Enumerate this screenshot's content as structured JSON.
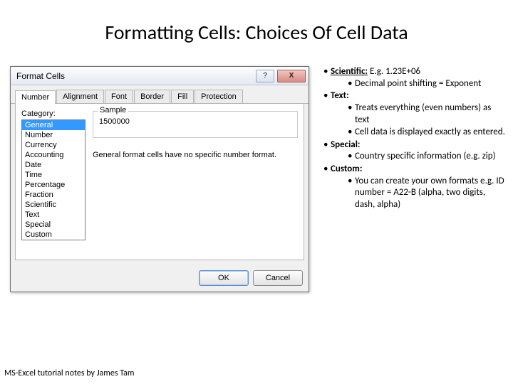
{
  "title": "Formatting Cells: Choices Of Cell Data",
  "dialog": {
    "title": "Format Cells",
    "help_glyph": "?",
    "close_glyph": "X",
    "tabs": [
      "Number",
      "Alignment",
      "Font",
      "Border",
      "Fill",
      "Protection"
    ],
    "category_label": "Category:",
    "categories": [
      "General",
      "Number",
      "Currency",
      "Accounting",
      "Date",
      "Time",
      "Percentage",
      "Fraction",
      "Scientific",
      "Text",
      "Special",
      "Custom"
    ],
    "sample_label": "Sample",
    "sample_value": "1500000",
    "description": "General format cells have no specific number format.",
    "ok": "OK",
    "cancel": "Cancel"
  },
  "notes": {
    "scientific_label": "Scientific:",
    "scientific_eg": " E.g. 1.23E+06",
    "scientific_sub": "Decimal point shifting = Exponent",
    "text_label": "Text:",
    "text_sub1": "Treats everything (even numbers) as text",
    "text_sub2": "Cell data is displayed exactly as entered.",
    "special_label": "Special:",
    "special_sub": "Country specific information (e.g. zip)",
    "custom_label": "Custom:",
    "custom_sub": "You can create your own formats e.g. ID number = A22-B (alpha, two digits, dash, alpha)"
  },
  "footnote": "MS-Excel tutorial notes by James Tam"
}
